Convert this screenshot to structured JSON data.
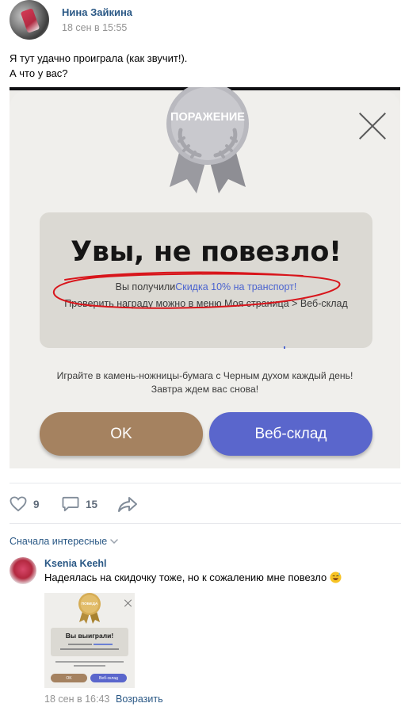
{
  "post": {
    "author": "Нина Зайкина",
    "date": "18 сен в 15:55",
    "text_line1": "Я тут удачно проиграла (как звучит!).",
    "text_line2": "А что у вас?"
  },
  "game_screenshot": {
    "medal_label": "ПОРАЖЕНИЕ",
    "result_title": "Увы, не повезло!",
    "reward_prefix": "Вы получили",
    "reward_link": "Скидка 10% на транспорт!",
    "check_text": "Проверить награду можно в меню Моя страница > Веб-склад",
    "invite_line1": "Играйте в камень-ножницы-бумага с Черным духом каждый день!",
    "invite_line2": "Завтра ждем вас снова!",
    "ok_button": "OK",
    "stash_button": "Веб-склад",
    "colors": {
      "ok_button": "#a58260",
      "stash_button": "#5a66cc",
      "link": "#4b64cf",
      "scribble": "#d8151b"
    }
  },
  "actions": {
    "likes": "9",
    "comments": "15"
  },
  "comments_section": {
    "sort_label": "Сначала интересные"
  },
  "comment": {
    "author": "Ksenia Keehl",
    "text": "Надеялась на скидочку тоже, но к сожалению мне повезло",
    "date": "18 сен в 16:43",
    "reply": "Возразить",
    "thumb": {
      "medal_label": "ПОБЕДА",
      "title": "Вы выиграли!",
      "ok_button": "OK",
      "stash_button": "Веб-склад"
    }
  },
  "brand": {
    "link_color": "#2a5885",
    "muted_color": "#939393"
  }
}
